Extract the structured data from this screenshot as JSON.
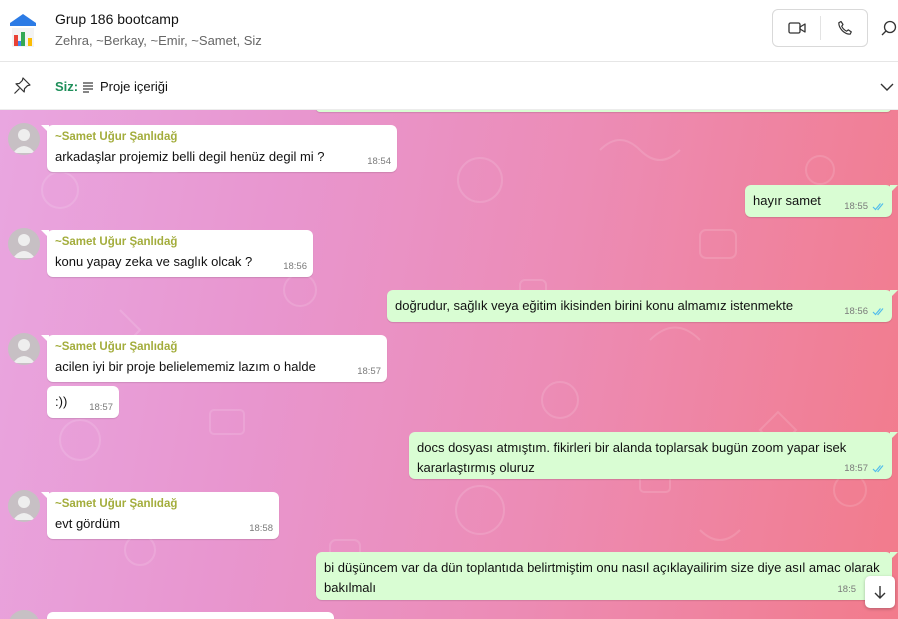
{
  "header": {
    "title": "Grup 186 bootcamp",
    "members": "Zehra, ~Berkay, ~Emir, ~Samet, Siz"
  },
  "pinned": {
    "sender": "Siz:",
    "text": "Proje içeriği"
  },
  "messages": [
    {
      "sender": "~Samet Uğur Şanlıdağ",
      "text": "arkadaşlar projemiz belli degil henüz degil mi ?",
      "time": "18:54"
    },
    {
      "text": "hayır samet",
      "time": "18:55"
    },
    {
      "sender": "~Samet Uğur Şanlıdağ",
      "text": "konu yapay zeka ve saglık olcak ?",
      "time": "18:56"
    },
    {
      "text": "doğrudur, sağlık veya eğitim ikisinden birini konu almamız istenmekte",
      "time": "18:56"
    },
    {
      "sender": "~Samet Uğur Şanlıdağ",
      "text": "acilen iyi bir proje belielememiz lazım o halde",
      "time": "18:57"
    },
    {
      "text": ":))",
      "time": "18:57"
    },
    {
      "text": "docs dosyası atmıştım. fikirleri bir alanda toplarsak bugün zoom yapar isek kararlaştırmış oluruz",
      "time": "18:57"
    },
    {
      "sender": "~Samet Uğur Şanlıdağ",
      "text": "evt gördüm",
      "time": "18:58"
    },
    {
      "text": "bi düşüncem var da dün toplantıda belirtmiştim onu nasıl açıklayailirim size diye asıl amac olarak bakılmalı",
      "time": "18:5"
    }
  ],
  "colors": {
    "sender_name": "#a3ad3c",
    "outgoing_bubble": "#d9fdd3",
    "read_ticks": "#53bdeb",
    "pinned_sender": "#1f8f5a"
  },
  "icons": [
    "video-call-icon",
    "voice-call-icon",
    "search-icon",
    "pin-icon",
    "document-icon",
    "chevron-down-icon",
    "double-check-icon",
    "arrow-down-icon",
    "default-avatar-icon"
  ]
}
